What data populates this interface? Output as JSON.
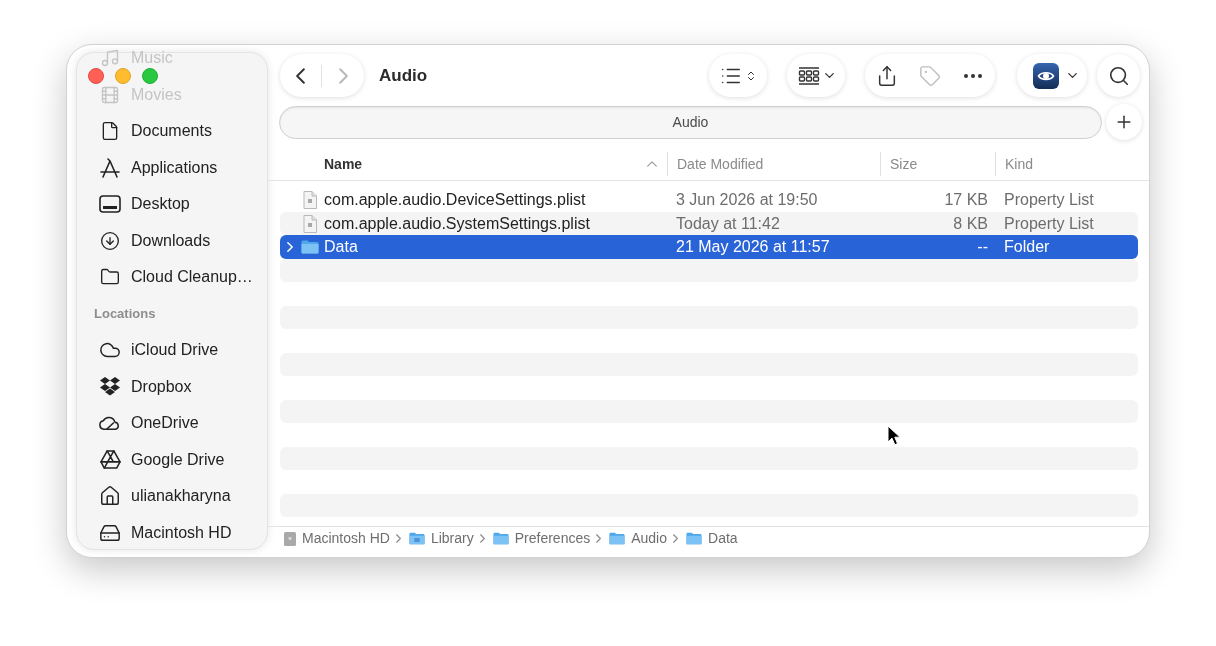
{
  "window": {
    "title": "Audio"
  },
  "toolbar": {
    "back": {
      "disabled": false
    },
    "forward": {
      "disabled": true
    },
    "tags": {
      "disabled": true
    }
  },
  "sidebar": {
    "items": [
      {
        "label": "Music",
        "dimmed": true
      },
      {
        "label": "Movies",
        "dimmed": true
      },
      {
        "label": "Documents",
        "dimmed": false
      },
      {
        "label": "Applications",
        "dimmed": false
      },
      {
        "label": "Desktop",
        "dimmed": false
      },
      {
        "label": "Downloads",
        "dimmed": false
      },
      {
        "label": "Cloud Cleanup…",
        "dimmed": false
      }
    ],
    "locations": {
      "header": "Locations",
      "items": [
        {
          "label": "iCloud Drive",
          "dimmed": false
        },
        {
          "label": "Dropbox",
          "dimmed": false
        },
        {
          "label": "OneDrive",
          "dimmed": false
        },
        {
          "label": "Google Drive",
          "dimmed": false
        },
        {
          "label": "ulianakharyna",
          "dimmed": false
        },
        {
          "label": "Macintosh HD",
          "dimmed": false
        }
      ]
    }
  },
  "path_field": {
    "value": "Audio"
  },
  "table": {
    "columns": [
      {
        "label": "Name",
        "sorted": true
      },
      {
        "label": "Date Modified",
        "sorted": false
      },
      {
        "label": "Size",
        "sorted": false
      },
      {
        "label": "Kind",
        "sorted": false
      }
    ],
    "rows": [
      {
        "kind": "document",
        "name": "com.apple.audio.DeviceSettings.plist",
        "date_modified": "3 Jun 2026 at 19:50",
        "size": "17 KB",
        "file_kind": "Property List",
        "selected": false
      },
      {
        "kind": "document",
        "name": "com.apple.audio.SystemSettings.plist",
        "date_modified": "Today at 11:42",
        "size": "8 KB",
        "file_kind": "Property List",
        "selected": false
      },
      {
        "kind": "folder",
        "name": "Data",
        "date_modified": "21 May 2026 at 11:57",
        "size": "--",
        "file_kind": "Folder",
        "selected": true
      }
    ]
  },
  "path_bar": [
    {
      "kind": "volume",
      "label": "Macintosh HD"
    },
    {
      "kind": "special-folder",
      "label": "Library"
    },
    {
      "kind": "folder",
      "label": "Preferences"
    },
    {
      "kind": "folder",
      "label": "Audio"
    },
    {
      "kind": "folder",
      "label": "Data"
    }
  ]
}
